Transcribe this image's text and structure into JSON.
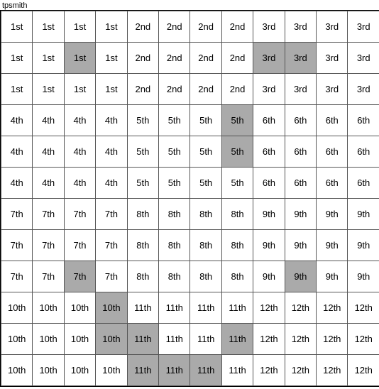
{
  "title": "tpsmith",
  "grid": {
    "rows": [
      [
        {
          "text": "1st",
          "hl": false
        },
        {
          "text": "1st",
          "hl": false
        },
        {
          "text": "1st",
          "hl": false
        },
        {
          "text": "1st",
          "hl": false
        },
        {
          "text": "2nd",
          "hl": false
        },
        {
          "text": "2nd",
          "hl": false
        },
        {
          "text": "2nd",
          "hl": false
        },
        {
          "text": "2nd",
          "hl": false
        },
        {
          "text": "3rd",
          "hl": false
        },
        {
          "text": "3rd",
          "hl": false
        },
        {
          "text": "3rd",
          "hl": false
        },
        {
          "text": "3rd",
          "hl": false
        }
      ],
      [
        {
          "text": "1st",
          "hl": false
        },
        {
          "text": "1st",
          "hl": false
        },
        {
          "text": "1st",
          "hl": true
        },
        {
          "text": "1st",
          "hl": false
        },
        {
          "text": "2nd",
          "hl": false
        },
        {
          "text": "2nd",
          "hl": false
        },
        {
          "text": "2nd",
          "hl": false
        },
        {
          "text": "2nd",
          "hl": false
        },
        {
          "text": "3rd",
          "hl": true
        },
        {
          "text": "3rd",
          "hl": true
        },
        {
          "text": "3rd",
          "hl": false
        },
        {
          "text": "3rd",
          "hl": false
        }
      ],
      [
        {
          "text": "1st",
          "hl": false
        },
        {
          "text": "1st",
          "hl": false
        },
        {
          "text": "1st",
          "hl": false
        },
        {
          "text": "1st",
          "hl": false
        },
        {
          "text": "2nd",
          "hl": false
        },
        {
          "text": "2nd",
          "hl": false
        },
        {
          "text": "2nd",
          "hl": false
        },
        {
          "text": "2nd",
          "hl": false
        },
        {
          "text": "3rd",
          "hl": false
        },
        {
          "text": "3rd",
          "hl": false
        },
        {
          "text": "3rd",
          "hl": false
        },
        {
          "text": "3rd",
          "hl": false
        }
      ],
      [
        {
          "text": "4th",
          "hl": false
        },
        {
          "text": "4th",
          "hl": false
        },
        {
          "text": "4th",
          "hl": false
        },
        {
          "text": "4th",
          "hl": false
        },
        {
          "text": "5th",
          "hl": false
        },
        {
          "text": "5th",
          "hl": false
        },
        {
          "text": "5th",
          "hl": false
        },
        {
          "text": "5th",
          "hl": true
        },
        {
          "text": "6th",
          "hl": false
        },
        {
          "text": "6th",
          "hl": false
        },
        {
          "text": "6th",
          "hl": false
        },
        {
          "text": "6th",
          "hl": false
        }
      ],
      [
        {
          "text": "4th",
          "hl": false
        },
        {
          "text": "4th",
          "hl": false
        },
        {
          "text": "4th",
          "hl": false
        },
        {
          "text": "4th",
          "hl": false
        },
        {
          "text": "5th",
          "hl": false
        },
        {
          "text": "5th",
          "hl": false
        },
        {
          "text": "5th",
          "hl": false
        },
        {
          "text": "5th",
          "hl": true
        },
        {
          "text": "6th",
          "hl": false
        },
        {
          "text": "6th",
          "hl": false
        },
        {
          "text": "6th",
          "hl": false
        },
        {
          "text": "6th",
          "hl": false
        }
      ],
      [
        {
          "text": "4th",
          "hl": false
        },
        {
          "text": "4th",
          "hl": false
        },
        {
          "text": "4th",
          "hl": false
        },
        {
          "text": "4th",
          "hl": false
        },
        {
          "text": "5th",
          "hl": false
        },
        {
          "text": "5th",
          "hl": false
        },
        {
          "text": "5th",
          "hl": false
        },
        {
          "text": "5th",
          "hl": false
        },
        {
          "text": "6th",
          "hl": false
        },
        {
          "text": "6th",
          "hl": false
        },
        {
          "text": "6th",
          "hl": false
        },
        {
          "text": "6th",
          "hl": false
        }
      ],
      [
        {
          "text": "7th",
          "hl": false
        },
        {
          "text": "7th",
          "hl": false
        },
        {
          "text": "7th",
          "hl": false
        },
        {
          "text": "7th",
          "hl": false
        },
        {
          "text": "8th",
          "hl": false
        },
        {
          "text": "8th",
          "hl": false
        },
        {
          "text": "8th",
          "hl": false
        },
        {
          "text": "8th",
          "hl": false
        },
        {
          "text": "9th",
          "hl": false
        },
        {
          "text": "9th",
          "hl": false
        },
        {
          "text": "9th",
          "hl": false
        },
        {
          "text": "9th",
          "hl": false
        }
      ],
      [
        {
          "text": "7th",
          "hl": false
        },
        {
          "text": "7th",
          "hl": false
        },
        {
          "text": "7th",
          "hl": false
        },
        {
          "text": "7th",
          "hl": false
        },
        {
          "text": "8th",
          "hl": false
        },
        {
          "text": "8th",
          "hl": false
        },
        {
          "text": "8th",
          "hl": false
        },
        {
          "text": "8th",
          "hl": false
        },
        {
          "text": "9th",
          "hl": false
        },
        {
          "text": "9th",
          "hl": false
        },
        {
          "text": "9th",
          "hl": false
        },
        {
          "text": "9th",
          "hl": false
        }
      ],
      [
        {
          "text": "7th",
          "hl": false
        },
        {
          "text": "7th",
          "hl": false
        },
        {
          "text": "7th",
          "hl": true
        },
        {
          "text": "7th",
          "hl": false
        },
        {
          "text": "8th",
          "hl": false
        },
        {
          "text": "8th",
          "hl": false
        },
        {
          "text": "8th",
          "hl": false
        },
        {
          "text": "8th",
          "hl": false
        },
        {
          "text": "9th",
          "hl": false
        },
        {
          "text": "9th",
          "hl": true
        },
        {
          "text": "9th",
          "hl": false
        },
        {
          "text": "9th",
          "hl": false
        }
      ],
      [
        {
          "text": "10th",
          "hl": false
        },
        {
          "text": "10th",
          "hl": false
        },
        {
          "text": "10th",
          "hl": false
        },
        {
          "text": "10th",
          "hl": true
        },
        {
          "text": "11th",
          "hl": false
        },
        {
          "text": "11th",
          "hl": false
        },
        {
          "text": "11th",
          "hl": false
        },
        {
          "text": "11th",
          "hl": false
        },
        {
          "text": "12th",
          "hl": false
        },
        {
          "text": "12th",
          "hl": false
        },
        {
          "text": "12th",
          "hl": false
        },
        {
          "text": "12th",
          "hl": false
        }
      ],
      [
        {
          "text": "10th",
          "hl": false
        },
        {
          "text": "10th",
          "hl": false
        },
        {
          "text": "10th",
          "hl": false
        },
        {
          "text": "10th",
          "hl": true
        },
        {
          "text": "11th",
          "hl": true
        },
        {
          "text": "11th",
          "hl": false
        },
        {
          "text": "11th",
          "hl": false
        },
        {
          "text": "11th",
          "hl": true
        },
        {
          "text": "12th",
          "hl": false
        },
        {
          "text": "12th",
          "hl": false
        },
        {
          "text": "12th",
          "hl": false
        },
        {
          "text": "12th",
          "hl": false
        }
      ],
      [
        {
          "text": "10th",
          "hl": false
        },
        {
          "text": "10th",
          "hl": false
        },
        {
          "text": "10th",
          "hl": false
        },
        {
          "text": "10th",
          "hl": false
        },
        {
          "text": "11th",
          "hl": true
        },
        {
          "text": "11th",
          "hl": true
        },
        {
          "text": "11th",
          "hl": true
        },
        {
          "text": "11th",
          "hl": false
        },
        {
          "text": "12th",
          "hl": false
        },
        {
          "text": "12th",
          "hl": false
        },
        {
          "text": "12th",
          "hl": false
        },
        {
          "text": "12th",
          "hl": false
        }
      ]
    ]
  }
}
